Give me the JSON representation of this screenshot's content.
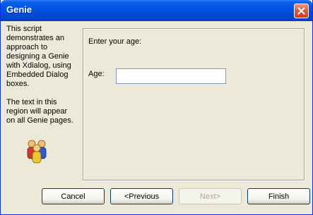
{
  "window": {
    "title": "Genie"
  },
  "sidebar": {
    "text": "This script demonstrates an approach to designing a Genie with Xdialog, using Embedded Dialog boxes.\n\nThe text in this region will appear on all Genie pages."
  },
  "page": {
    "prompt": "Enter your age:",
    "age_label": "Age:",
    "age_value": "",
    "age_placeholder": ""
  },
  "buttons": {
    "cancel": "Cancel",
    "previous": "<Previous",
    "next": "Next>",
    "finish": "Finish"
  },
  "colors": {
    "titlebar": "#0054E3",
    "dialog_bg": "#ECE9D8",
    "close_button": "#E0563A"
  },
  "icons": [
    "close-icon",
    "people-icon"
  ]
}
